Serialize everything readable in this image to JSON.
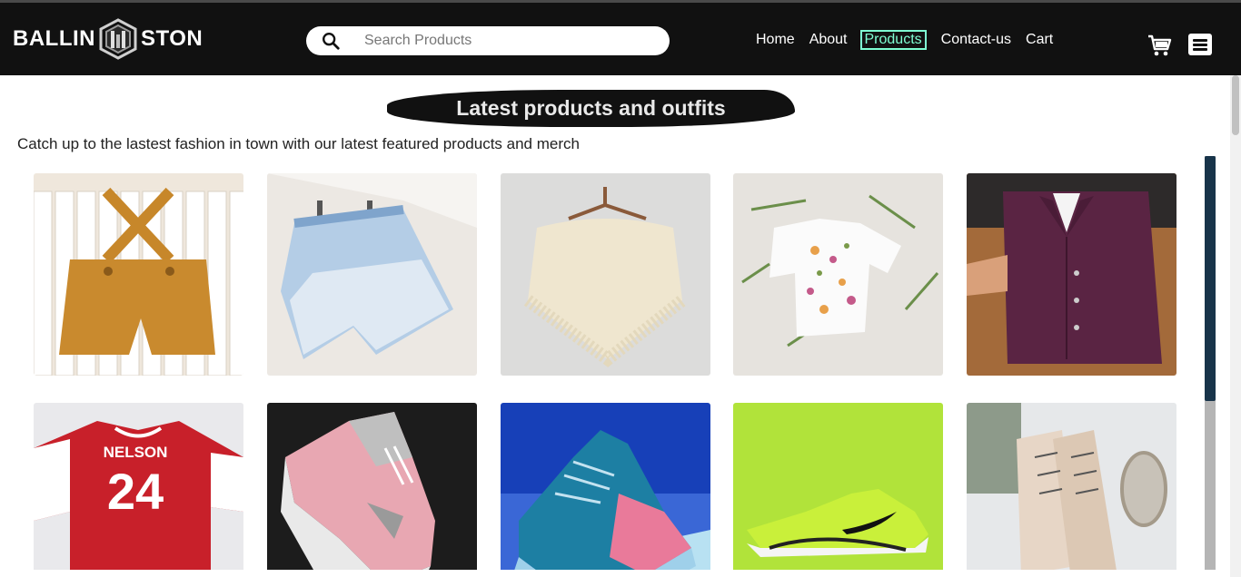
{
  "brand": {
    "left": "BALLIN",
    "right": "STON"
  },
  "search": {
    "placeholder": "Search Products",
    "value": ""
  },
  "nav": {
    "items": [
      {
        "label": "Home",
        "active": false
      },
      {
        "label": "About",
        "active": false
      },
      {
        "label": "Products",
        "active": true
      },
      {
        "label": "Contact-us",
        "active": false
      },
      {
        "label": "Cart",
        "active": false
      }
    ]
  },
  "icons": {
    "search": "search-icon",
    "cart": "cart-icon",
    "menu": "hamburger-menu-icon"
  },
  "colors": {
    "navbar": "#111111",
    "active_link": "#7fffd4",
    "scroll_thumb": "#18344a"
  },
  "section": {
    "title": "Latest products and outfits",
    "subtitle": "Catch up to the lastest fashion in town with our latest featured products and merch"
  },
  "products": [
    {
      "name": "mustard-overall-shorts"
    },
    {
      "name": "denim-bloomers"
    },
    {
      "name": "knit-poncho"
    },
    {
      "name": "floral-tshirt"
    },
    {
      "name": "purple-dress-shirt"
    },
    {
      "name": "red-jersey",
      "jersey_name": "NELSON",
      "jersey_number": "24"
    },
    {
      "name": "pink-sneaker"
    },
    {
      "name": "blue-pink-sneaker"
    },
    {
      "name": "lime-sneaker"
    },
    {
      "name": "lace-up-boots"
    }
  ]
}
